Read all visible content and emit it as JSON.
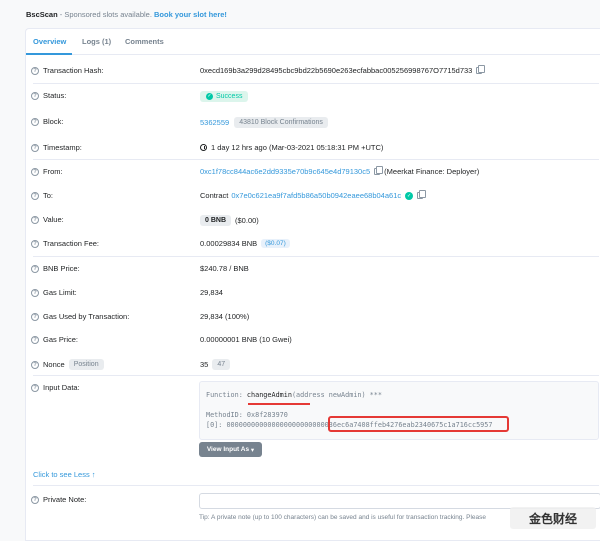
{
  "sponsor": {
    "brand": "BscScan",
    "text": " - Sponsored slots available. ",
    "link": "Book your slot here!"
  },
  "tabs": [
    {
      "label": "Overview",
      "active": true
    },
    {
      "label": "Logs (1)",
      "active": false
    },
    {
      "label": "Comments",
      "active": false
    }
  ],
  "fields": {
    "tx_hash": {
      "label": "Transaction Hash:",
      "value": "0xecd169b3a299d28495cbc9bd22b5690e263ecfabbac005256998767O7715d733"
    },
    "status": {
      "label": "Status:",
      "value": "Success"
    },
    "block": {
      "label": "Block:",
      "value": "5362559",
      "confirmations": "43810 Block Confirmations"
    },
    "timestamp": {
      "label": "Timestamp:",
      "value": "1 day 12 hrs ago (Mar-03-2021 05:18:31 PM +UTC)"
    },
    "from": {
      "label": "From:",
      "address": "0xc1f78cc844ac6e2dd9335e70b9c645e4d79130c5",
      "note": "(Meerkat Finance: Deployer)"
    },
    "to": {
      "label": "To:",
      "prefix": "Contract",
      "address": "0x7e0c621ea9f7afd5b86a50b0942eaee68b04a61c"
    },
    "value": {
      "label": "Value:",
      "amount": "0 BNB",
      "usd": "($0.00)"
    },
    "fee": {
      "label": "Transaction Fee:",
      "amount": "0.00029834 BNB",
      "usd": "($0.07)"
    },
    "bnb_price": {
      "label": "BNB Price:",
      "value": "$240.78 / BNB"
    },
    "gas_limit": {
      "label": "Gas Limit:",
      "value": "29,834"
    },
    "gas_used": {
      "label": "Gas Used by Transaction:",
      "value": "29,834 (100%)"
    },
    "gas_price": {
      "label": "Gas Price:",
      "value": "0.00000001 BNB (10 Gwei)"
    },
    "nonce": {
      "label": "Nonce",
      "badge": "Position",
      "value": "35",
      "position": "47"
    },
    "input": {
      "label": "Input Data:",
      "function_prefix": "Function: ",
      "function_name": "changeAdmin",
      "function_args": "(address newAdmin) ***",
      "method_id": "MethodID: 0x8f283970",
      "param0": "[0]:  000000000000000000000000036ec6a7408ffeb4276eab2340675c1a716cc5957",
      "button": "View Input As"
    }
  },
  "see_less": "Click to see Less",
  "private_note": {
    "label": "Private Note:",
    "tip": "Tip: A private note (up to 100 characters) can be saved and is useful for transaction tracking. Please"
  },
  "watermark": "金色财经",
  "colors": {
    "link": "#3498db",
    "success": "#00c9a7",
    "highlight": "#e53935"
  }
}
